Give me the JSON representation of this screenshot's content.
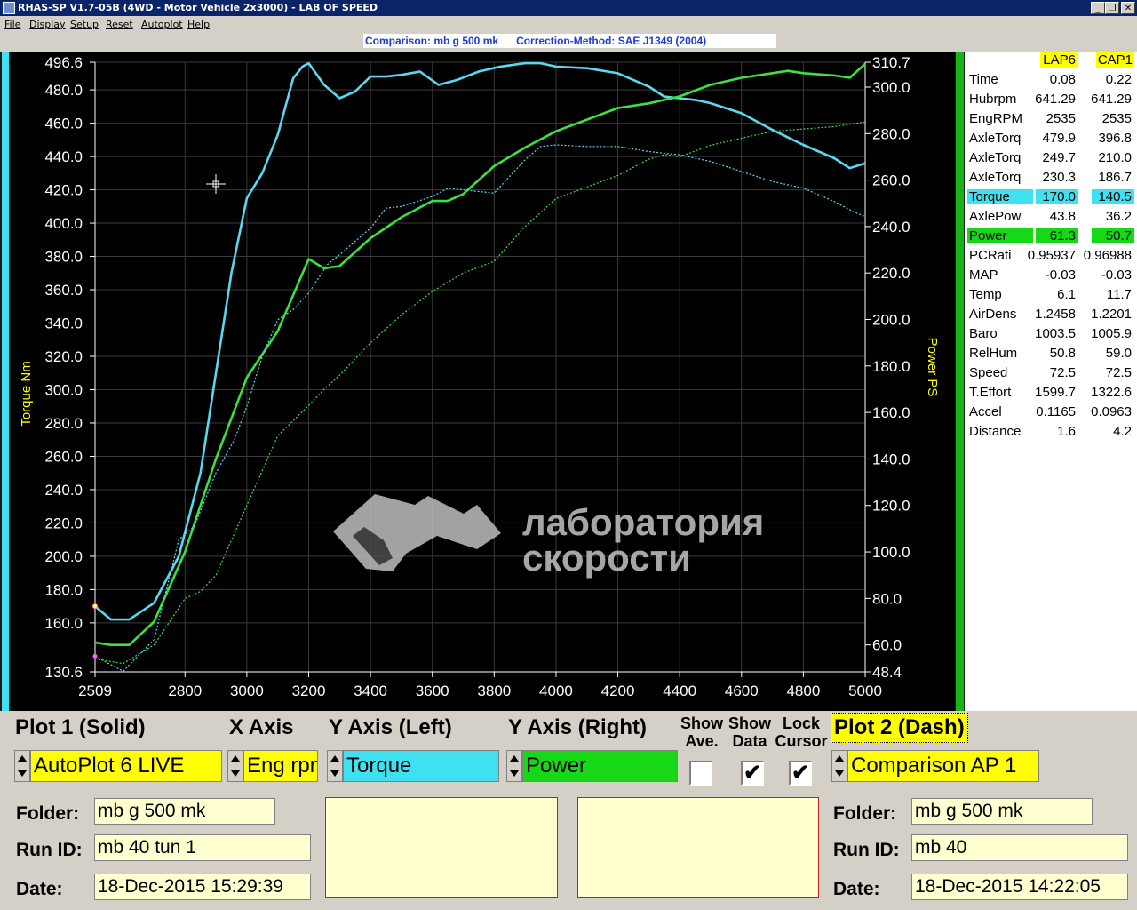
{
  "window": {
    "title": "RHAS-SP V1.7-05B  (4WD - Motor Vehicle 2x3000) - LAB OF SPEED",
    "minimize_glyph": "_",
    "restore_glyph": "❐",
    "close_glyph": "✕"
  },
  "menu": [
    "File",
    "Display",
    "Setup",
    "Reset",
    "Autoplot",
    "Help"
  ],
  "info": {
    "comparison": "Comparison: mb g 500 mk",
    "correction": "Correction-Method: SAE J1349 (2004)"
  },
  "watermark": {
    "line1": "лаборатория",
    "line2": "скорости"
  },
  "chart_data": {
    "type": "line",
    "ylabel": "Torque Nm",
    "y2label": "Power PS",
    "xlim": [
      2509,
      5000
    ],
    "ylim": [
      130.6,
      496.6
    ],
    "y2lim": [
      48.4,
      310.7
    ],
    "x_ticks": [
      "2509",
      "2800",
      "3000",
      "3200",
      "3400",
      "3600",
      "3800",
      "4000",
      "4200",
      "4400",
      "4600",
      "4800",
      "5000"
    ],
    "y_ticks": [
      "496.6",
      "480.0",
      "460.0",
      "440.0",
      "420.0",
      "400.0",
      "380.0",
      "360.0",
      "340.0",
      "320.0",
      "300.0",
      "280.0",
      "260.0",
      "240.0",
      "220.0",
      "200.0",
      "180.0",
      "160.0",
      "130.6"
    ],
    "y2_ticks": [
      "310.7",
      "300.0",
      "280.0",
      "260.0",
      "240.0",
      "220.0",
      "200.0",
      "180.0",
      "160.0",
      "140.0",
      "120.0",
      "100.0",
      "80.0",
      "60.0",
      "48.4"
    ],
    "series": [
      {
        "name": "Torque",
        "axis": "left",
        "style": "solid",
        "color": "#5ad8f0",
        "x": [
          2509,
          2560,
          2620,
          2700,
          2780,
          2850,
          2900,
          2950,
          3000,
          3050,
          3100,
          3150,
          3180,
          3200,
          3250,
          3300,
          3350,
          3400,
          3450,
          3500,
          3560,
          3620,
          3680,
          3750,
          3820,
          3900,
          3950,
          4000,
          4100,
          4200,
          4300,
          4350,
          4400,
          4450,
          4500,
          4600,
          4700,
          4800,
          4900,
          4950,
          5000
        ],
        "y": [
          170,
          162,
          162,
          172,
          200,
          250,
          310,
          370,
          415,
          430,
          453,
          487,
          494,
          496,
          483,
          475,
          479,
          488,
          488,
          489,
          491,
          483,
          486,
          491,
          494,
          496,
          496,
          494,
          493,
          490,
          482,
          476,
          475,
          474,
          472,
          466,
          456,
          447,
          439,
          433,
          436
        ]
      },
      {
        "name": "Power",
        "axis": "right",
        "style": "solid",
        "color": "#3ee03e",
        "x": [
          2509,
          2560,
          2620,
          2700,
          2800,
          2900,
          3000,
          3100,
          3200,
          3250,
          3300,
          3400,
          3500,
          3600,
          3650,
          3700,
          3800,
          3900,
          4000,
          4100,
          4200,
          4300,
          4400,
          4500,
          4600,
          4700,
          4750,
          4800,
          4900,
          4950,
          5000
        ],
        "y": [
          61,
          60,
          60,
          70,
          100,
          140,
          175,
          195,
          226,
          222,
          223,
          235,
          244,
          251,
          251,
          254,
          266,
          274,
          281,
          286,
          291,
          293,
          296,
          301,
          304,
          306,
          307,
          306,
          305,
          304,
          310
        ]
      },
      {
        "name": "Torque",
        "axis": "left",
        "style": "dash",
        "color": "#5ad8f0",
        "x": [
          2509,
          2600,
          2700,
          2780,
          2830,
          2900,
          2960,
          3000,
          3050,
          3100,
          3150,
          3200,
          3260,
          3300,
          3400,
          3450,
          3500,
          3600,
          3650,
          3700,
          3800,
          3900,
          3950,
          4000,
          4100,
          4200,
          4300,
          4400,
          4500,
          4600,
          4700,
          4800,
          4900,
          4960,
          5000
        ],
        "y": [
          140,
          131,
          150,
          210,
          218,
          250,
          270,
          290,
          320,
          342,
          348,
          358,
          375,
          381,
          397,
          409,
          410,
          416,
          421,
          420,
          418,
          438,
          446,
          447,
          446,
          446,
          443,
          441,
          437,
          431,
          425,
          421,
          413,
          407,
          404
        ]
      },
      {
        "name": "Power",
        "axis": "right",
        "style": "dash",
        "color": "#3ee03e",
        "x": [
          2509,
          2600,
          2700,
          2800,
          2850,
          2900,
          3000,
          3100,
          3200,
          3250,
          3300,
          3400,
          3500,
          3600,
          3700,
          3800,
          3900,
          4000,
          4100,
          4200,
          4300,
          4350,
          4400,
          4500,
          4600,
          4700,
          4800,
          4900,
          5000
        ],
        "y": [
          54,
          52,
          60,
          80,
          83,
          90,
          120,
          150,
          163,
          170,
          176,
          190,
          202,
          212,
          220,
          225,
          240,
          252,
          257,
          262,
          269,
          271,
          270,
          275,
          278,
          281,
          282,
          283,
          285
        ]
      }
    ]
  },
  "datapanel": {
    "header": [
      "",
      "LAP6",
      "CAP1"
    ],
    "rows": [
      [
        "Time",
        "0.08",
        "0.22"
      ],
      [
        "Hubrpm",
        "641.29",
        "641.29"
      ],
      [
        "EngRPM",
        "2535",
        "2535"
      ],
      [
        "AxleTorq",
        "479.9",
        "396.8"
      ],
      [
        "AxleTorq",
        "249.7",
        "210.0"
      ],
      [
        "AxleTorq",
        "230.3",
        "186.7"
      ],
      [
        "Torque",
        "170.0",
        "140.5"
      ],
      [
        "AxlePow",
        "43.8",
        "36.2"
      ],
      [
        "Power",
        "61.3",
        "50.7"
      ],
      [
        "PCRati",
        "0.95937",
        "0.96988"
      ],
      [
        "MAP",
        "-0.03",
        "-0.03"
      ],
      [
        "Temp",
        "6.1",
        "11.7"
      ],
      [
        "AirDens",
        "1.2458",
        "1.2201"
      ],
      [
        "Baro",
        "1003.5",
        "1005.9"
      ],
      [
        "RelHum",
        "50.8",
        "59.0"
      ],
      [
        "Speed",
        "72.5",
        "72.5"
      ],
      [
        "T.Effort",
        "1599.7",
        "1322.6"
      ],
      [
        "Accel",
        "0.1165",
        "0.0963"
      ],
      [
        "Distance",
        "1.6",
        "4.2"
      ]
    ]
  },
  "controls": {
    "plot1_label": "Plot 1 (Solid)",
    "xaxis_label": "X Axis",
    "yleft_label": "Y Axis (Left)",
    "yright_label": "Y Axis (Right)",
    "show_ave_1": "Show",
    "show_ave_2": "Ave.",
    "show_data_1": "Show",
    "show_data_2": "Data",
    "lock_cursor_1": "Lock",
    "lock_cursor_2": "Cursor",
    "plot2_label": "Plot 2 (Dash)",
    "plot1_value": "AutoPlot 6 LIVE",
    "xaxis_value": "Eng rpm",
    "yleft_value": "Torque",
    "yright_value": "Power",
    "plot2_value": "Comparison AP 1",
    "check_mark": "✔",
    "show_ave_checked": false,
    "show_data_checked": true,
    "lock_cursor_checked": true
  },
  "fields": {
    "folder_label": "Folder:",
    "runid_label": "Run ID:",
    "date_label": "Date:",
    "plot1_folder": "mb g 500 mk",
    "plot1_runid": "mb 40 tun 1",
    "plot1_date": "18-Dec-2015  15:29:39",
    "plot2_folder": "mb g 500 mk",
    "plot2_runid": "mb 40",
    "plot2_date": "18-Dec-2015  14:22:05"
  },
  "colors": {
    "torque": "#3fe0f0",
    "power": "#17d817",
    "axis_text": "#ffffff",
    "axis_title": "#ffff00",
    "plot_bg": "#000000",
    "selector_yellow": "#ffff00"
  }
}
